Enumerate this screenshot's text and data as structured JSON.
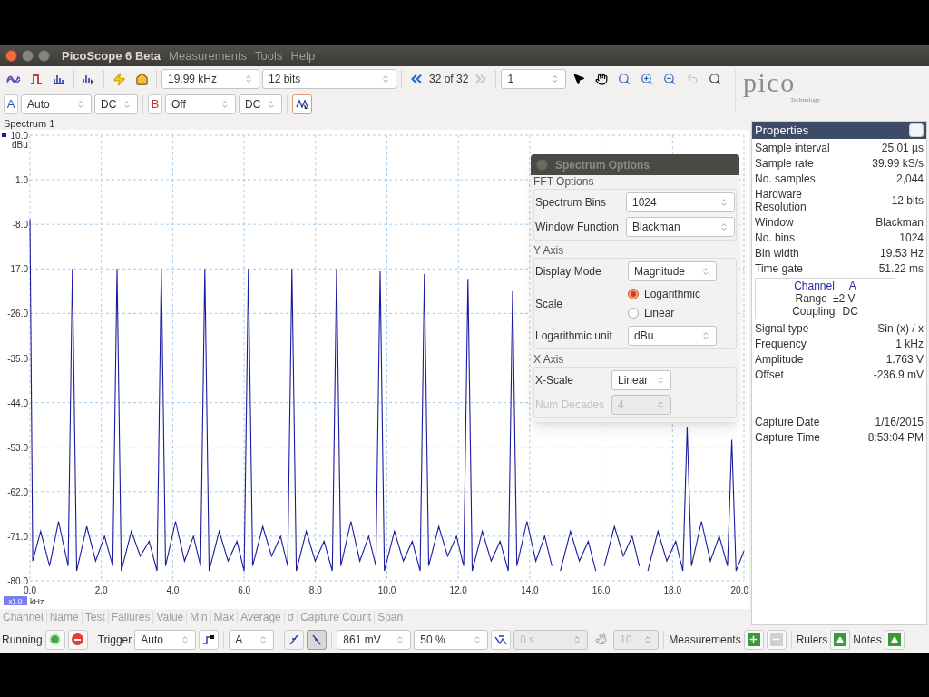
{
  "window": {
    "title": "PicoScope 6 Beta",
    "menu": [
      "Measurements",
      "Tools",
      "Help"
    ]
  },
  "toolbar": {
    "timebase": "19.99 kHz",
    "resolution": "12 bits",
    "buffer": {
      "position": "32 of 32",
      "index": "1",
      "previous_disabled": false,
      "next_disabled": true
    },
    "channels": [
      {
        "label": "A",
        "color": "#2a4fc0",
        "range": "Auto",
        "coupling": "DC"
      },
      {
        "label": "B",
        "color": "#d03030",
        "range": "Off",
        "coupling": "DC"
      }
    ]
  },
  "logo": {
    "text": "pico",
    "subtitle": "Technology"
  },
  "view": {
    "title": "Spectrum 1",
    "zoom": "x1.0",
    "chart_data": {
      "type": "line",
      "ylabel": "dBu",
      "xlabel": "kHz",
      "grid": true,
      "xlim": [
        0,
        20
      ],
      "ylim": [
        -80,
        10
      ],
      "xticks": [
        {
          "value": 0,
          "label": "0.0"
        },
        {
          "value": 2,
          "label": "2.0"
        },
        {
          "value": 4,
          "label": "4.0"
        },
        {
          "value": 6,
          "label": "6.0"
        },
        {
          "value": 8,
          "label": "8.0"
        },
        {
          "value": 10,
          "label": "10.0"
        },
        {
          "value": 12,
          "label": "12.0"
        },
        {
          "value": 14,
          "label": "14.0"
        },
        {
          "value": 16,
          "label": "16.0"
        },
        {
          "value": 18,
          "label": "18.0"
        },
        {
          "value": 20,
          "label": "20.0"
        }
      ],
      "yticks": [
        {
          "value": 10,
          "label": "10.0"
        },
        {
          "value": 1,
          "label": "1.0"
        },
        {
          "value": -8,
          "label": "-8.0"
        },
        {
          "value": -17,
          "label": "-17.0"
        },
        {
          "value": -26,
          "label": "-26.0"
        },
        {
          "value": -35,
          "label": "-35.0"
        },
        {
          "value": -44,
          "label": "-44.0"
        },
        {
          "value": -53,
          "label": "-53.0"
        },
        {
          "value": -62,
          "label": "-62.0"
        },
        {
          "value": -71,
          "label": "-71.0"
        },
        {
          "value": -80,
          "label": "-80.0"
        }
      ],
      "x": [
        0,
        0.08,
        0.3,
        0.55,
        0.8,
        1.07,
        1.19,
        1.31,
        1.59,
        1.84,
        2.09,
        2.32,
        2.44,
        2.56,
        2.84,
        3.09,
        3.34,
        3.56,
        3.68,
        3.8,
        4.08,
        4.33,
        4.58,
        4.78,
        4.9,
        5.02,
        5.3,
        5.55,
        5.8,
        6.0,
        6.12,
        6.24,
        6.52,
        6.77,
        7.02,
        7.22,
        7.34,
        7.46,
        7.74,
        7.99,
        8.24,
        8.47,
        8.59,
        8.71,
        8.99,
        9.24,
        9.49,
        9.69,
        9.81,
        9.93,
        10.21,
        10.46,
        10.71,
        10.93,
        11.05,
        11.17,
        11.45,
        11.7,
        11.95,
        12.15,
        12.27,
        12.39,
        12.67,
        12.92,
        13.17,
        13.4,
        13.52,
        13.64,
        13.92,
        14.17,
        14.42,
        14.62,
        14.74,
        14.86,
        15.14,
        15.39,
        15.64,
        15.85,
        15.97,
        16.09,
        16.37,
        16.62,
        16.87,
        17.07,
        17.19,
        17.31,
        17.59,
        17.84,
        18.09,
        18.29,
        18.41,
        18.53,
        18.81,
        19.06,
        19.31,
        19.54,
        19.66,
        19.78,
        20
      ],
      "series": [
        {
          "color": "#1a1aa0",
          "values": [
            -7,
            -76,
            -70,
            -77,
            -68,
            -77,
            -17,
            -78,
            -69,
            -76,
            -71,
            -77,
            -17,
            -78,
            -70,
            -75,
            -72,
            -78,
            -17,
            -77,
            -68,
            -76,
            -71,
            -77,
            -17,
            -78,
            -70,
            -76,
            -72,
            -78,
            -17,
            -77,
            -69,
            -75,
            -71,
            -77,
            -17,
            -78,
            -70,
            -76,
            -72,
            -78,
            -17,
            -77,
            -68,
            -76,
            -71,
            -77,
            -17.5,
            -78,
            -70,
            -76,
            -72,
            -78,
            -18,
            -77,
            -69,
            -75,
            -71,
            -77,
            -19,
            -78,
            -70,
            -76,
            -72,
            -78,
            -21.5,
            -77,
            -68,
            -76,
            -71,
            -77,
            null,
            -78,
            -70,
            -76,
            -72,
            -78,
            null,
            -77,
            -69,
            -75,
            -71,
            -77,
            null,
            -78,
            -70,
            -76,
            -72,
            -78,
            -49,
            -77,
            -68,
            -76,
            -71,
            -77,
            -51.5,
            -78,
            -74
          ]
        }
      ]
    }
  },
  "measurements_table": {
    "columns": [
      "Channel",
      "Name",
      "Test",
      "Failures",
      "Value",
      "Min",
      "Max",
      "Average",
      "σ",
      "Capture Count",
      "Span"
    ]
  },
  "properties": {
    "title": "Properties",
    "rows": [
      {
        "label": "Sample interval",
        "value": "25.01 µs"
      },
      {
        "label": "Sample rate",
        "value": "39.99 kS/s"
      },
      {
        "label": "No. samples",
        "value": "2,044"
      },
      {
        "label": "Hardware Resolution",
        "value": "12 bits"
      },
      {
        "label": "Window",
        "value": "Blackman"
      },
      {
        "label": "No. bins",
        "value": "1024"
      },
      {
        "label": "Bin width",
        "value": "19.53 Hz"
      },
      {
        "label": "Time gate",
        "value": "51.22 ms"
      }
    ],
    "channel": {
      "label": "Channel",
      "name": "A",
      "range_label": "Range",
      "range": "±2 V",
      "coupling_label": "Coupling",
      "coupling": "DC"
    },
    "signal_rows": [
      {
        "label": "Signal type",
        "value": "Sin (x) / x"
      },
      {
        "label": "Frequency",
        "value": "1 kHz"
      },
      {
        "label": "Amplitude",
        "value": "1.763 V"
      },
      {
        "label": "Offset",
        "value": "-236.9 mV"
      }
    ],
    "capture_rows": [
      {
        "label": "Capture Date",
        "value": "1/16/2015"
      },
      {
        "label": "Capture Time",
        "value": "8:53:04 PM"
      }
    ]
  },
  "spectrum_options": {
    "title": "Spectrum Options",
    "sections": [
      {
        "title": "FFT Options",
        "fields": [
          {
            "kind": "select",
            "label": "Spectrum Bins",
            "value": "1024",
            "disabled": false
          },
          {
            "kind": "select",
            "label": "Window Function",
            "value": "Blackman",
            "disabled": false
          }
        ]
      },
      {
        "title": "Y Axis",
        "fields": [
          {
            "kind": "select",
            "label": "Display Mode",
            "value": "Magnitude",
            "disabled": false
          },
          {
            "kind": "radio",
            "label": "Scale",
            "options": [
              {
                "label": "Logarithmic",
                "selected": true
              },
              {
                "label": "Linear",
                "selected": false
              }
            ]
          },
          {
            "kind": "select",
            "label": "Logarithmic unit",
            "value": "dBu",
            "disabled": false
          }
        ]
      },
      {
        "title": "X Axis",
        "fields": [
          {
            "kind": "select",
            "label": "X-Scale",
            "value": "Linear",
            "disabled": false
          },
          {
            "kind": "select",
            "label": "Num Decades",
            "value": "4",
            "disabled": true
          }
        ]
      }
    ]
  },
  "status_bar": {
    "run_label": "Running",
    "trigger_label": "Trigger",
    "trigger_mode": "Auto",
    "trigger_channel": "A",
    "edges": [
      {
        "kind": "rising",
        "selected": false
      },
      {
        "kind": "falling",
        "selected": true
      }
    ],
    "threshold": "861 mV",
    "pre_trigger": "50 %",
    "delay": {
      "value": "0 s",
      "disabled": true
    },
    "count": {
      "value": "10",
      "disabled": true
    },
    "measurements_label": "Measurements",
    "remove_measurement": {
      "disabled": true
    },
    "rulers_label": "Rulers",
    "notes_label": "Notes"
  }
}
